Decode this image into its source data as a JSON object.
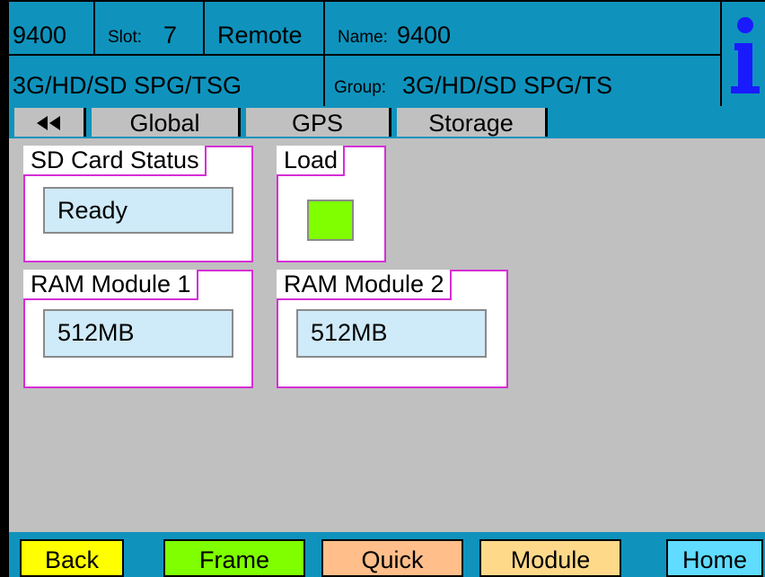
{
  "header": {
    "device": "9400",
    "slot_label": "Slot:",
    "slot_value": "7",
    "mode": "Remote",
    "name_label": "Name:",
    "name_value": "9400",
    "product": "3G/HD/SD SPG/TSG",
    "group_label": "Group:",
    "group_value": "3G/HD/SD SPG/TS",
    "info_icon": "info-icon",
    "color": "#0f93bd"
  },
  "tabs": {
    "back_icon": "double-left-arrow-icon",
    "items": [
      {
        "label": "Global"
      },
      {
        "label": "GPS"
      },
      {
        "label": "Storage"
      }
    ]
  },
  "panels": {
    "sd_card": {
      "title": "SD Card Status",
      "value": "Ready"
    },
    "load": {
      "title": "Load",
      "led_color": "#7fff00"
    },
    "ram1": {
      "title": "RAM Module 1",
      "value": "512MB"
    },
    "ram2": {
      "title": "RAM Module 2",
      "value": "512MB"
    }
  },
  "footer": {
    "buttons": [
      {
        "label": "Back",
        "color": "#ffff00"
      },
      {
        "label": "Frame",
        "color": "#7fff00"
      },
      {
        "label": "Quick",
        "color": "#ffbe8a"
      },
      {
        "label": "Module",
        "color": "#ffd98a"
      },
      {
        "label": "Home",
        "color": "#5fdcff"
      }
    ]
  }
}
